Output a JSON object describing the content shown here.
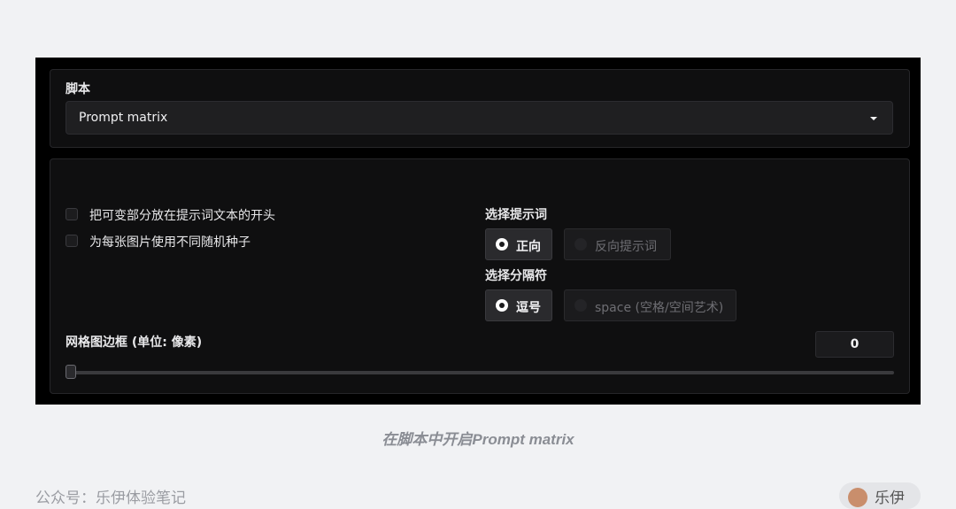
{
  "script_panel": {
    "label": "脚本",
    "selected": "Prompt matrix"
  },
  "options": {
    "checkbox1": "把可变部分放在提示词文本的开头",
    "checkbox2": "为每张图片使用不同随机种子",
    "prompt_group_label": "选择提示词",
    "prompt_options": [
      "正向",
      "反向提示词"
    ],
    "prompt_selected": "正向",
    "delim_group_label": "选择分隔符",
    "delim_options": [
      "逗号",
      "space (空格/空间艺术)"
    ],
    "delim_selected": "逗号",
    "margin_label": "网格图边框 (单位: 像素)",
    "margin_value": "0",
    "slider_fraction": 0
  },
  "caption": "在脚本中开启Prompt matrix",
  "footer": {
    "left": "公众号：乐伊体验笔记",
    "author": "乐伊"
  }
}
